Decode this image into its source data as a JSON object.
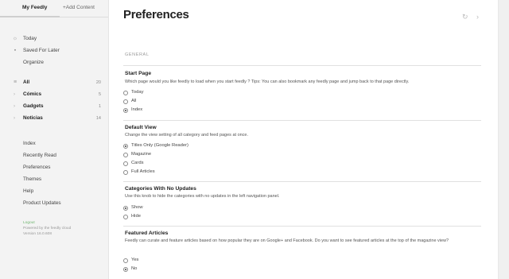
{
  "sidebar": {
    "tabs": {
      "my_feedly": "My Feedly",
      "add_content": "+Add Content"
    },
    "nav": [
      {
        "label": "Today",
        "icon": "sun-icon"
      },
      {
        "label": "Saved For Later",
        "icon": "bookmark-icon"
      },
      {
        "label": "Organize",
        "icon": ""
      }
    ],
    "categories": [
      {
        "label": "All",
        "count": "20"
      },
      {
        "label": "Cómics",
        "count": "5"
      },
      {
        "label": "Gadgets",
        "count": "1"
      },
      {
        "label": "Noticias",
        "count": "14"
      }
    ],
    "links": [
      "Index",
      "Recently Read",
      "Preferences",
      "Themes",
      "Help",
      "Product Updates"
    ],
    "footer": {
      "logout": "Logout",
      "powered": "Powered by the feedly cloud",
      "version": "Version 16.0.608"
    }
  },
  "main": {
    "title": "Preferences",
    "section_label": "GENERAL",
    "prefs": [
      {
        "heading": "Start Page",
        "description": "Which page would you like feedly to load when you start feedly ? Tips: You can also bookmark any feedly page and jump back to that page directly.",
        "options": [
          "Today",
          "All",
          "Index"
        ],
        "selected": "Index"
      },
      {
        "heading": "Default View",
        "description": "Change the view setting of all category and feed pages at once.",
        "options": [
          "Titles Only (Google Reader)",
          "Magazine",
          "Cards",
          "Full Articles"
        ],
        "selected": "Titles Only (Google Reader)"
      },
      {
        "heading": "Categories With No Updates",
        "description": "Use this knob to hide the categories with no updates in the left navigation panel.",
        "options": [
          "Show",
          "Hide"
        ],
        "selected": "Show"
      },
      {
        "heading": "Featured Articles",
        "description": "Feedly can curate and feature articles based on how popular they are on Google+ and Facebook. Do you want to see featured articles at the top of the magazine view?",
        "options": [
          "Yes",
          "No"
        ],
        "selected": "No"
      }
    ]
  }
}
